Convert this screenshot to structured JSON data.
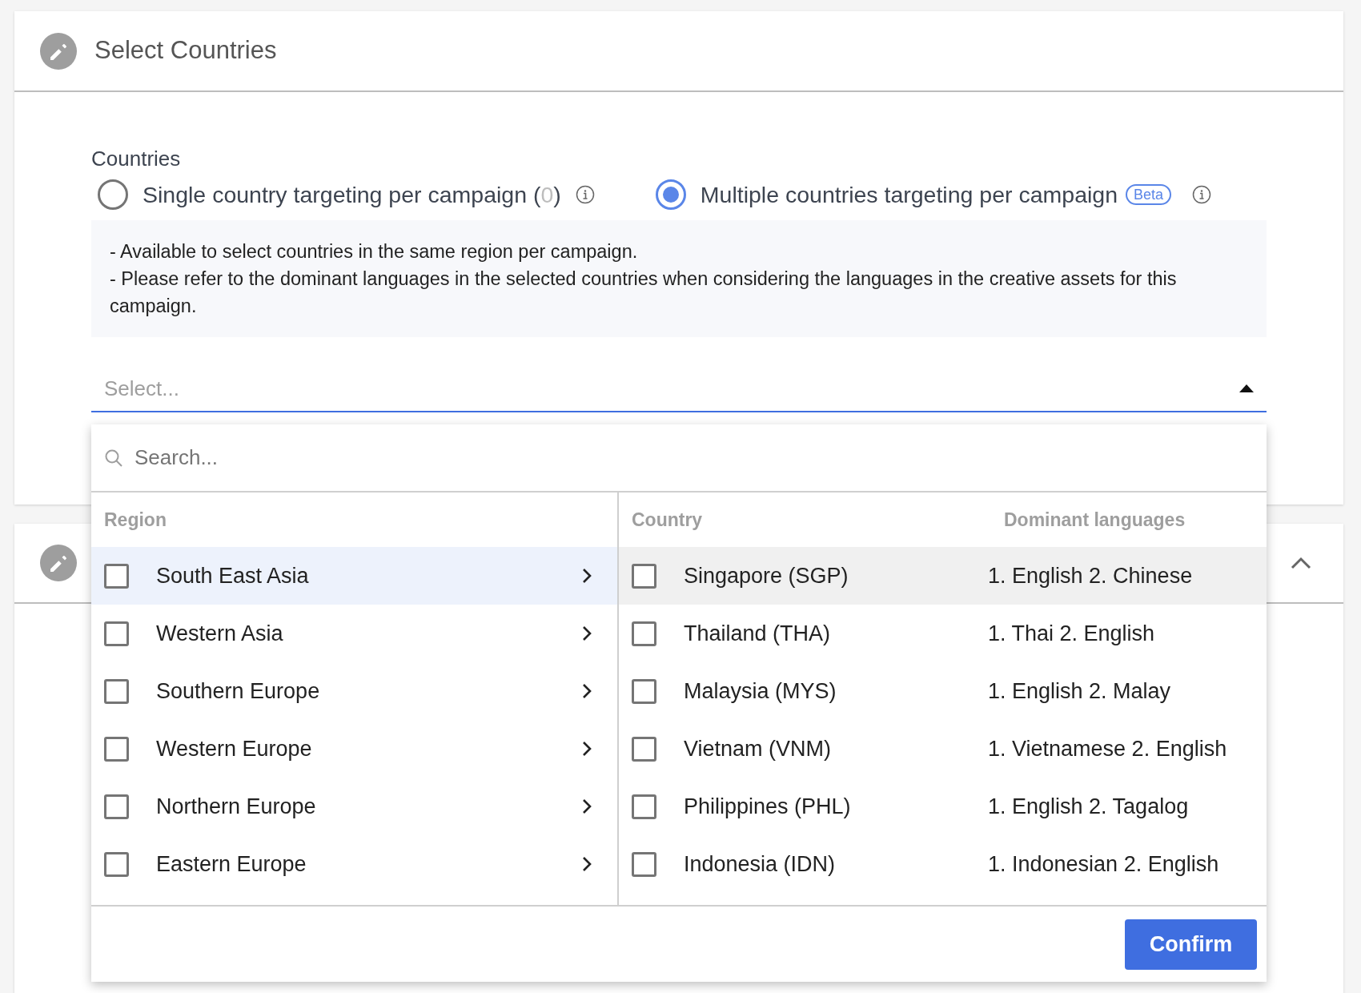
{
  "section": {
    "title": "Select Countries"
  },
  "countries": {
    "label": "Countries",
    "options": [
      {
        "label": "Single country targeting per campaign (",
        "count": "0",
        "suffix": ")",
        "selected": false
      },
      {
        "label": "Multiple countries targeting per campaign",
        "badge": "Beta",
        "selected": true
      }
    ],
    "notes": [
      "- Available to select countries in the same region per campaign.",
      "- Please refer to the dominant languages in the selected countries when considering the languages in the creative assets for this campaign."
    ],
    "select": {
      "placeholder": "Select...",
      "expanded": true
    }
  },
  "dropdown": {
    "search_placeholder": "Search...",
    "region_header": "Region",
    "country_header": "Country",
    "languages_header": "Dominant languages",
    "regions": [
      {
        "name": "South East Asia",
        "checked": false,
        "selected": true
      },
      {
        "name": "Western Asia",
        "checked": false,
        "selected": false
      },
      {
        "name": "Southern Europe",
        "checked": false,
        "selected": false
      },
      {
        "name": "Western Europe",
        "checked": false,
        "selected": false
      },
      {
        "name": "Northern Europe",
        "checked": false,
        "selected": false
      },
      {
        "name": "Eastern Europe",
        "checked": false,
        "selected": false
      }
    ],
    "countries": [
      {
        "name": "Singapore (SGP)",
        "languages": "1. English 2. Chinese",
        "checked": false,
        "selected": true
      },
      {
        "name": "Thailand (THA)",
        "languages": "1. Thai 2. English",
        "checked": false,
        "selected": false
      },
      {
        "name": "Malaysia (MYS)",
        "languages": "1. English 2. Malay",
        "checked": false,
        "selected": false
      },
      {
        "name": "Vietnam (VNM)",
        "languages": "1. Vietnamese 2. English",
        "checked": false,
        "selected": false
      },
      {
        "name": "Philippines (PHL)",
        "languages": "1. English 2. Tagalog",
        "checked": false,
        "selected": false
      },
      {
        "name": "Indonesia (IDN)",
        "languages": "1. Indonesian 2. English",
        "checked": false,
        "selected": false
      }
    ],
    "confirm": "Confirm"
  },
  "next_section": {
    "expanded": true
  }
}
